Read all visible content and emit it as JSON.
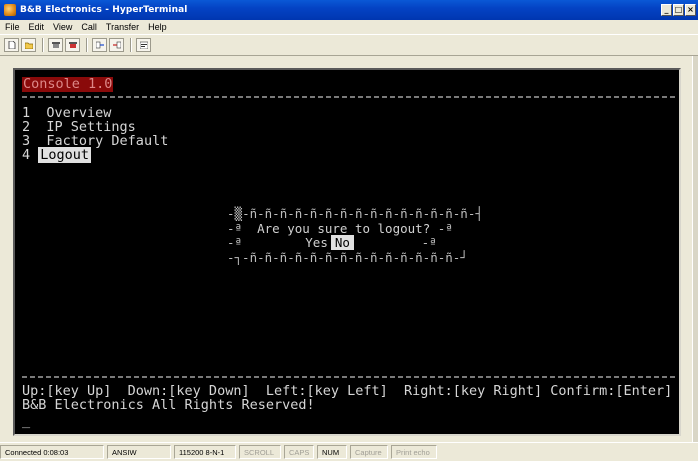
{
  "window": {
    "title": "B&B Electronics - HyperTerminal",
    "controls": [
      "_",
      "□",
      "×"
    ]
  },
  "menu": [
    "File",
    "Edit",
    "View",
    "Call",
    "Transfer",
    "Help"
  ],
  "toolbar": {
    "icons": [
      "new-icon",
      "open-icon",
      "phone-icon",
      "disconnect-icon",
      "send-icon",
      "receive-icon",
      "properties-icon"
    ]
  },
  "terminal": {
    "header": "Console 1.0",
    "menu_items": [
      {
        "num": "1",
        "label": "Overview",
        "selected": false
      },
      {
        "num": "2",
        "label": "IP Settings",
        "selected": false
      },
      {
        "num": "3",
        "label": "Factory Default",
        "selected": false
      },
      {
        "num": "4",
        "label": "Logout",
        "selected": true
      }
    ],
    "dialog": {
      "top_border": "-ñ-ñ-ñ-ñ-ñ-ñ-ñ-ñ-ñ-ñ-ñ-ñ-ñ-ñ-ñ-┤",
      "bottom_border": "-┐-ñ-ñ-ñ-ñ-ñ-ñ-ñ-ñ-ñ-ñ-ñ-ñ-ñ-ñ-┘",
      "side_left": "-ª",
      "side_right": "-ª",
      "message": "Are you sure to logout?",
      "yes_label": "Yes",
      "no_label": "No"
    },
    "footer_keys": "Up:[key Up]  Down:[key Down]  Left:[key Left]  Right:[key Right] Confirm:[Enter]",
    "footer_copyright": "B&B Electronics All Rights Reserved!",
    "cursor": "_"
  },
  "status": {
    "connected": "Connected 0:08:03",
    "emulation": "ANSIW",
    "settings": "115200 8-N-1",
    "scroll": "SCROLL",
    "caps": "CAPS",
    "num": "NUM",
    "capture": "Capture",
    "print_echo": "Print echo"
  }
}
